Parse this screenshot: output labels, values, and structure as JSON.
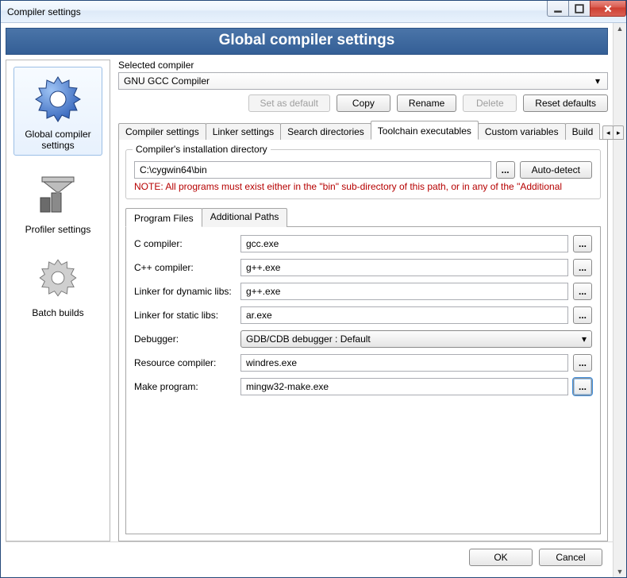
{
  "window": {
    "title": "Compiler settings"
  },
  "banner": "Global compiler settings",
  "sidebar": {
    "items": [
      {
        "label": "Global compiler settings"
      },
      {
        "label": "Profiler settings"
      },
      {
        "label": "Batch builds"
      }
    ]
  },
  "selected_compiler": {
    "label": "Selected compiler",
    "value": "GNU GCC Compiler"
  },
  "compiler_buttons": {
    "set_default": "Set as default",
    "copy": "Copy",
    "rename": "Rename",
    "delete": "Delete",
    "reset": "Reset defaults"
  },
  "tabs": {
    "items": [
      {
        "label": "Compiler settings"
      },
      {
        "label": "Linker settings"
      },
      {
        "label": "Search directories"
      },
      {
        "label": "Toolchain executables"
      },
      {
        "label": "Custom variables"
      },
      {
        "label": "Build"
      }
    ]
  },
  "install_dir": {
    "legend": "Compiler's installation directory",
    "path": "C:\\cygwin64\\bin",
    "auto_detect": "Auto-detect",
    "note": "NOTE: All programs must exist either in the \"bin\" sub-directory of this path, or in any of the \"Additional"
  },
  "inner_tabs": {
    "program_files": "Program Files",
    "additional_paths": "Additional Paths"
  },
  "program_files": {
    "rows": [
      {
        "label": "C compiler:",
        "value": "gcc.exe",
        "kind": "text"
      },
      {
        "label": "C++ compiler:",
        "value": "g++.exe",
        "kind": "text"
      },
      {
        "label": "Linker for dynamic libs:",
        "value": "g++.exe",
        "kind": "text"
      },
      {
        "label": "Linker for static libs:",
        "value": "ar.exe",
        "kind": "text"
      },
      {
        "label": "Debugger:",
        "value": "GDB/CDB debugger : Default",
        "kind": "combo"
      },
      {
        "label": "Resource compiler:",
        "value": "windres.exe",
        "kind": "text"
      },
      {
        "label": "Make program:",
        "value": "mingw32-make.exe",
        "kind": "text",
        "focused": true
      }
    ]
  },
  "footer": {
    "ok": "OK",
    "cancel": "Cancel"
  }
}
